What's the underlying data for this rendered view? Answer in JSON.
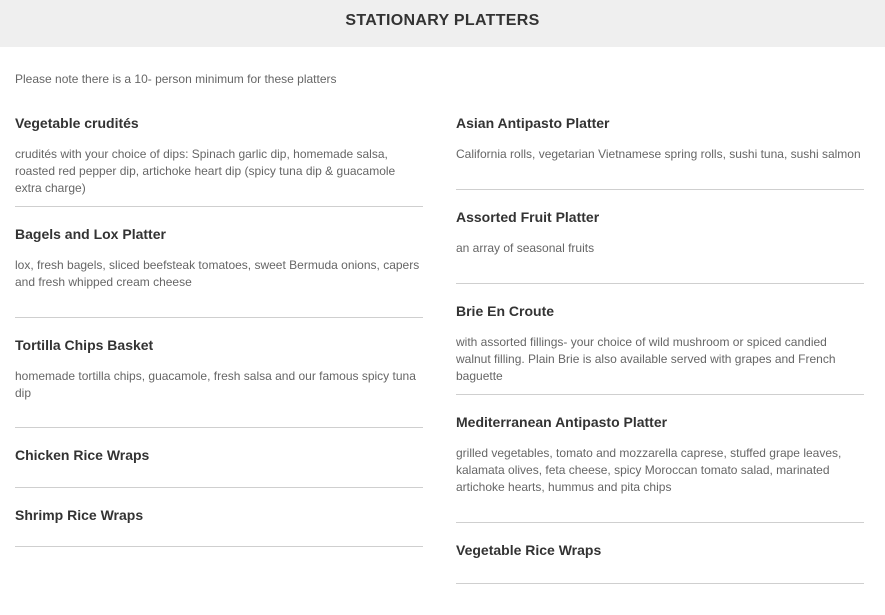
{
  "header": {
    "title": "STATIONARY PLATTERS"
  },
  "note": "Please note there is a 10- person minimum for these platters",
  "left_items": [
    {
      "title": "Vegetable crudités",
      "desc": "crudités with your choice of dips: Spinach garlic dip, homemade salsa, roasted red pepper dip, artichoke heart dip (spicy tuna dip & guacamole extra charge)"
    },
    {
      "title": "Bagels and Lox Platter",
      "desc": "lox, fresh bagels, sliced beefsteak tomatoes, sweet Bermuda onions, capers and fresh whipped cream cheese"
    },
    {
      "title": "Tortilla Chips Basket",
      "desc": "homemade tortilla chips, guacamole, fresh salsa and our famous spicy tuna dip"
    },
    {
      "title": "Chicken Rice Wraps"
    },
    {
      "title": "Shrimp Rice Wraps"
    }
  ],
  "right_items": [
    {
      "title": "Asian Antipasto Platter",
      "desc": "California rolls, vegetarian Vietnamese spring rolls, sushi tuna, sushi salmon"
    },
    {
      "title": "Assorted Fruit Platter",
      "desc": "an array of seasonal fruits"
    },
    {
      "title": "Brie En Croute",
      "desc": "with assorted fillings- your choice of wild mushroom or spiced candied walnut filling. Plain Brie is also available served with grapes and French baguette"
    },
    {
      "title": "Mediterranean Antipasto Platter",
      "desc": "grilled vegetables, tomato and mozzarella caprese, stuffed grape leaves, kalamata olives, feta cheese, spicy Moroccan tomato salad, marinated artichoke hearts, hummus and pita chips"
    },
    {
      "title": "Vegetable Rice Wraps"
    }
  ]
}
